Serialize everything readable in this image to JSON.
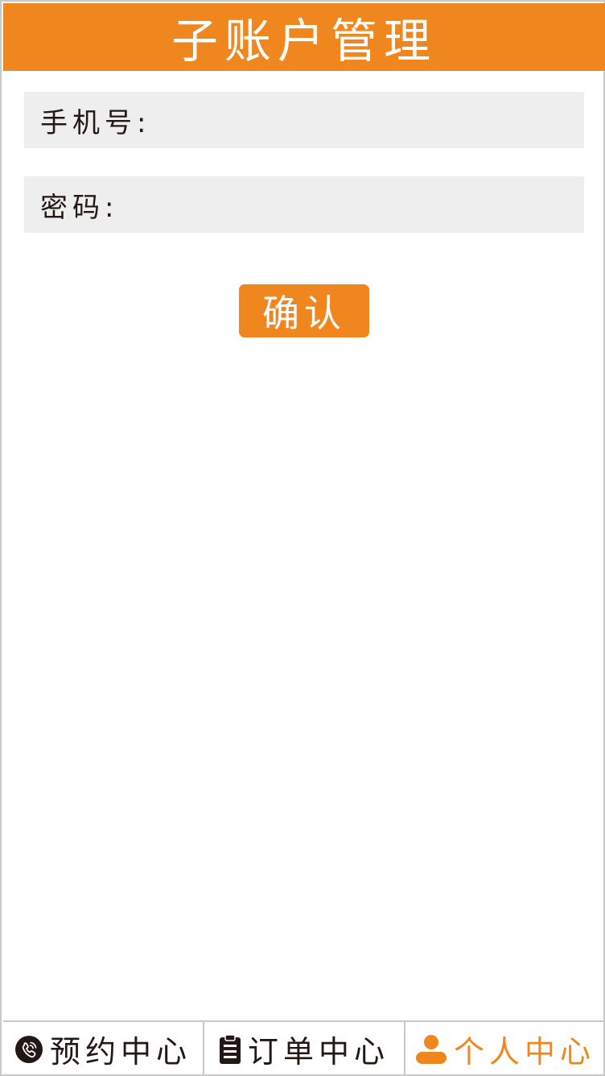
{
  "header": {
    "title": "子账户管理",
    "background_color": "#f0871e"
  },
  "form": {
    "phone_label": "手机号:",
    "phone_value": "",
    "password_label": "密码:",
    "password_value": "",
    "confirm_label": "确认"
  },
  "tabbar": {
    "tabs": [
      {
        "label": "预约中心",
        "icon": "phone-icon",
        "active": false
      },
      {
        "label": "订单中心",
        "icon": "clipboard-icon",
        "active": false
      },
      {
        "label": "个人中心",
        "icon": "person-icon",
        "active": true
      }
    ],
    "active_color": "#f0871e",
    "text_color": "#231815"
  }
}
